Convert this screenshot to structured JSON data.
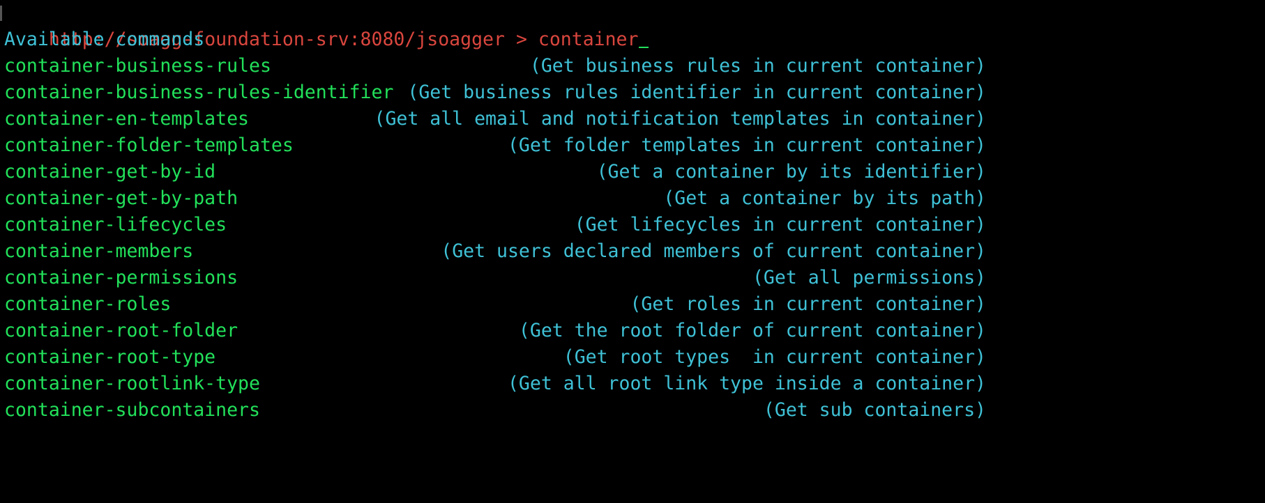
{
  "prompt": {
    "url": "http://soagg-foundation-srv:8080/jsoagger",
    "separator": ">",
    "input": "container"
  },
  "heading": "Available commands",
  "commands": [
    {
      "name": "container-business-rules",
      "description": "(Get business rules in current container)"
    },
    {
      "name": "container-business-rules-identifier",
      "description": "(Get business rules identifier in current container)"
    },
    {
      "name": "container-en-templates",
      "description": "(Get all email and notification templates in container)"
    },
    {
      "name": "container-folder-templates",
      "description": "(Get folder templates in current container)"
    },
    {
      "name": "container-get-by-id",
      "description": "(Get a container by its identifier)"
    },
    {
      "name": "container-get-by-path",
      "description": "(Get a container by its path)"
    },
    {
      "name": "container-lifecycles",
      "description": "(Get lifecycles in current container)"
    },
    {
      "name": "container-members",
      "description": "(Get users declared members of current container)"
    },
    {
      "name": "container-permissions",
      "description": "(Get all permissions)"
    },
    {
      "name": "container-roles",
      "description": "(Get roles in current container)"
    },
    {
      "name": "container-root-folder",
      "description": "(Get the root folder of current container)"
    },
    {
      "name": "container-root-type",
      "description": "(Get root types  in current container)"
    },
    {
      "name": "container-rootlink-type",
      "description": "(Get all root link type inside a container)"
    },
    {
      "name": "container-subcontainers",
      "description": "(Get sub containers)"
    }
  ],
  "colors": {
    "background": "#000000",
    "prompt": "#d9463e",
    "command": "#22e05a",
    "description": "#3fc1d6"
  }
}
